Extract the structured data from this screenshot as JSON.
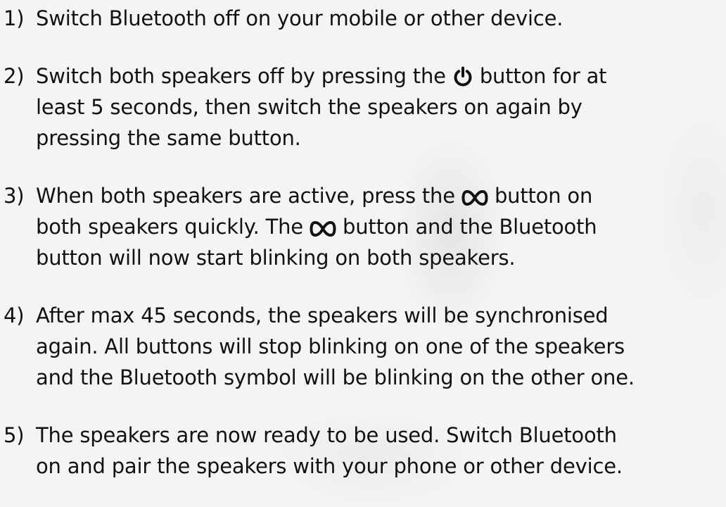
{
  "steps": [
    {
      "number": "1)",
      "lines": [
        "Switch Bluetooth off on your mobile or other device."
      ]
    },
    {
      "number": "2)",
      "line1_before_icon": "Switch both speakers off by pressing the",
      "line1_after_icon": "button for at",
      "icon": "power-icon",
      "lines": [
        "least 5 seconds, then switch the speakers on again by",
        "pressing the same button."
      ]
    },
    {
      "number": "3)",
      "line1_before_icon": "When both speakers are active, press the",
      "line1_after_icon": "button on",
      "line2_before_icon": "both speakers quickly. The",
      "line2_after_icon": "button and the Bluetooth",
      "icon": "infinity-icon",
      "lines": [
        "button will now start blinking on both speakers."
      ]
    },
    {
      "number": "4)",
      "lines": [
        "After max 45 seconds, the speakers will be synchronised",
        "again. All buttons will stop blinking on one of the speakers",
        "and the Bluetooth symbol will be blinking on the other one."
      ]
    },
    {
      "number": "5)",
      "lines": [
        "The speakers are now ready to be used. Switch Bluetooth",
        "on and pair the speakers with your phone or other device."
      ]
    }
  ]
}
